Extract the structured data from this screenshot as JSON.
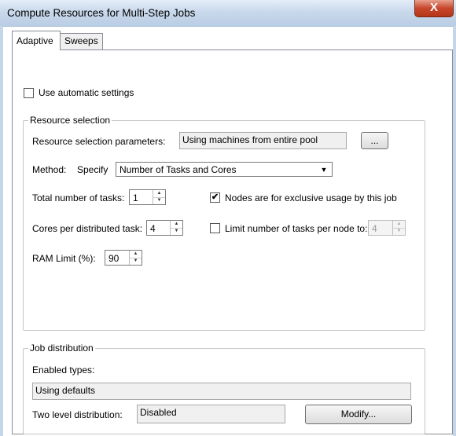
{
  "window": {
    "title": "Compute Resources for Multi-Step Jobs",
    "close_glyph": "X"
  },
  "tabs": [
    {
      "label": "Adaptive",
      "active": true
    },
    {
      "label": "Sweeps",
      "active": false
    }
  ],
  "adaptive": {
    "use_automatic_settings": {
      "label": "Use automatic settings",
      "checked": false
    },
    "resource_selection": {
      "title": "Resource selection",
      "params_label": "Resource selection parameters:",
      "params_value": "Using machines from entire pool",
      "browse_label": "...",
      "method_label": "Method:",
      "specify_label": "Specify",
      "method_value": "Number of Tasks and Cores",
      "total_tasks_label": "Total number of tasks:",
      "total_tasks_value": "1",
      "exclusive": {
        "label": "Nodes are for exclusive usage by this job",
        "checked": true
      },
      "cores_label": "Cores per distributed task:",
      "cores_value": "4",
      "limit_tasks": {
        "label": "Limit number of tasks per node to:",
        "checked": false,
        "value": "4"
      },
      "ram_label": "RAM Limit (%):",
      "ram_value": "90"
    },
    "job_distribution": {
      "title": "Job distribution",
      "enabled_types_label": "Enabled types:",
      "enabled_types_value": "Using defaults",
      "two_level_label": "Two level distribution:",
      "two_level_value": "Disabled",
      "modify_label": "Modify..."
    }
  }
}
